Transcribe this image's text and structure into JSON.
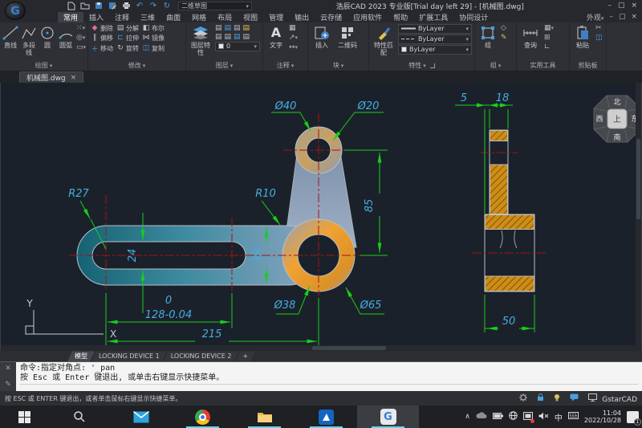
{
  "title": {
    "app": "浩辰CAD 2023 专业版[Trial day left 29] - [机械图.dwg]",
    "workspace": "二维草图"
  },
  "menu": {
    "tabs": [
      "常用",
      "插入",
      "注释",
      "三维",
      "曲面",
      "网格",
      "布局",
      "视图",
      "管理",
      "输出",
      "云存储",
      "应用软件",
      "帮助",
      "扩展工具",
      "协同设计"
    ],
    "appearance": "外观"
  },
  "ribbon": {
    "draw": {
      "label": "绘图",
      "line": "直线",
      "pline": "多段线",
      "circle": "圆",
      "arc": "圆弧"
    },
    "modify": {
      "label": "修改",
      "erase": "删除",
      "explode": "分解",
      "bool": "布尔",
      "offset": "偏移",
      "stretch": "拉伸",
      "mirror": "镜像",
      "move": "移动",
      "rotate": "旋转",
      "copy": "复制"
    },
    "layer": {
      "label": "图层",
      "props": "图层特性",
      "current": "0"
    },
    "annotate": {
      "label": "注释",
      "text": "文字"
    },
    "block": {
      "label": "块",
      "insert": "插入",
      "qr": "二维码"
    },
    "props": {
      "label": "特性",
      "match": "特性匹配",
      "bylayer1": "ByLayer",
      "bylayer2": "ByLayer",
      "bylayer3": "ByLayer"
    },
    "group": {
      "label": "组",
      "group": "组"
    },
    "utils": {
      "label": "实用工具",
      "inquiry": "查询"
    },
    "clip": {
      "label": "剪贴板",
      "paste": "粘贴"
    }
  },
  "file_tab": "机械图.dwg",
  "dims": {
    "d40": "Ø40",
    "d20": "Ø20",
    "r27": "R27",
    "r10": "R10",
    "h24": "24",
    "h38": "38",
    "v85": "85",
    "tol0": "0",
    "tol128": "128-0.04",
    "len215": "215",
    "d38": "Ø38",
    "d65": "Ø65",
    "w5": "5",
    "w18": "18",
    "w50": "50"
  },
  "viewcube": {
    "n": "北",
    "s": "南",
    "e": "东",
    "w": "西",
    "top": "上"
  },
  "ucs": {
    "x": "X",
    "y": "Y"
  },
  "layouts": {
    "model": "模型",
    "t1": "LOCKING DEVICE 1",
    "t2": "LOCKING DEVICE 2",
    "add": "+"
  },
  "cmd": {
    "l1": "命令:指定对角点: '_pan",
    "l2": "按 Esc 或 Enter 键退出, 或单击右键显示快捷菜单。"
  },
  "status": {
    "hint": "按 ESC 或 ENTER 键退出，或者单击鼠标右键显示快捷菜单。",
    "brand": "GstarCAD"
  },
  "taskbar": {
    "time": "11:04",
    "date": "2022/10/28",
    "ime": "中",
    "badge": "1"
  },
  "colors": {
    "dim_green": "#18cf18",
    "dim_text": "#45aede",
    "centerline": "#a51212",
    "accent_blue": "#4a9ede",
    "hatch_orange": "#cf8d15"
  }
}
